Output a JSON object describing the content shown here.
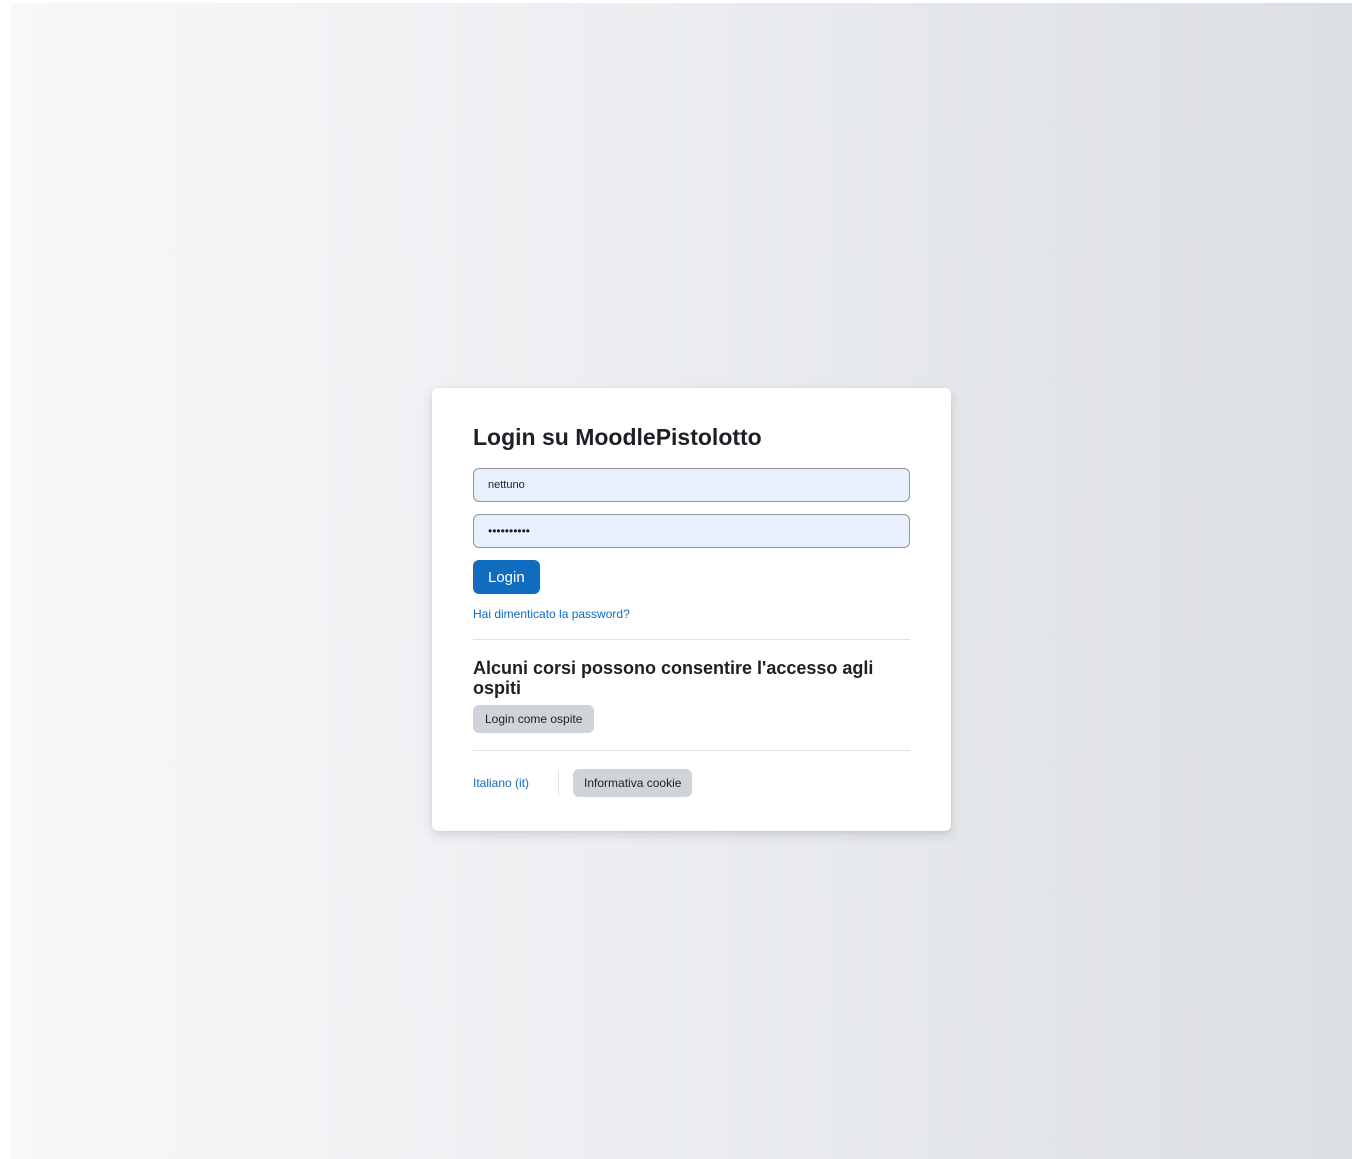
{
  "login": {
    "title": "Login su MoodlePistolotto",
    "username_value": "nettuno",
    "password_value": "••••••••••",
    "login_button": "Login",
    "forgot_password": "Hai dimenticato la password?"
  },
  "guest": {
    "heading": "Alcuni corsi possono consentire l'accesso agli ospiti",
    "button": "Login come ospite"
  },
  "footer": {
    "language": "Italiano (it)",
    "cookie_button": "Informativa cookie"
  },
  "colors": {
    "primary": "#0f6cbf",
    "secondary_button": "#ced4da",
    "autofill_bg": "#e8f0fe"
  }
}
